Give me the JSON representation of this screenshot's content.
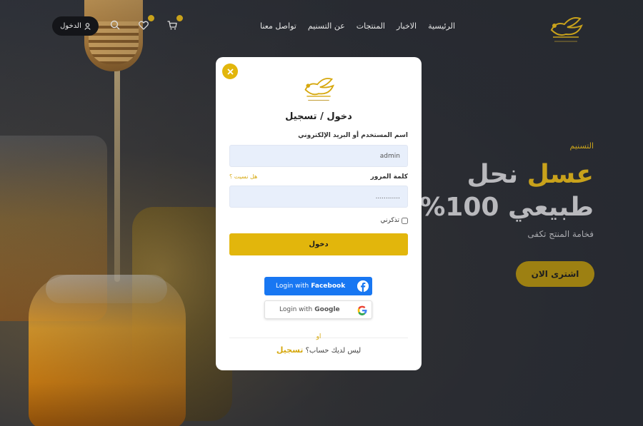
{
  "nav": {
    "links": [
      "الرئيسية",
      "الاخبار",
      "المنتجات",
      "عن التسنيم",
      "تواصل معنا"
    ],
    "login_label": "الدخول",
    "cart_icon": "cart-icon",
    "wishlist_icon": "heart-icon",
    "search_icon": "search-icon"
  },
  "hero": {
    "tag": "التسنيم",
    "title_gold": "عسل",
    "title_rest": "نحل",
    "title_line2": "طبيعي 100%",
    "subtitle": "فخامة المنتج تكفى",
    "button": "اشترى الان"
  },
  "modal": {
    "title": "دخول / تسجيل",
    "username_label": "اسم المستخدم أو البريد الإلكتروني",
    "username_value": "admin",
    "password_label": "كلمة المرور",
    "forgot_label": "هل نسيت ؟",
    "password_value": "............",
    "remember_label": "تذكرني",
    "submit_label": "دخول",
    "facebook_prefix": "Login with",
    "facebook_brand": "Facebook",
    "google_prefix": "Login with",
    "google_brand": "Google",
    "or_label": "او",
    "no_account_text": "ليس لديك حساب؟",
    "register_label": "تسجيل"
  },
  "colors": {
    "accent": "#e2b60c",
    "facebook": "#1877f2",
    "dark_bg": "#2a2d33"
  }
}
